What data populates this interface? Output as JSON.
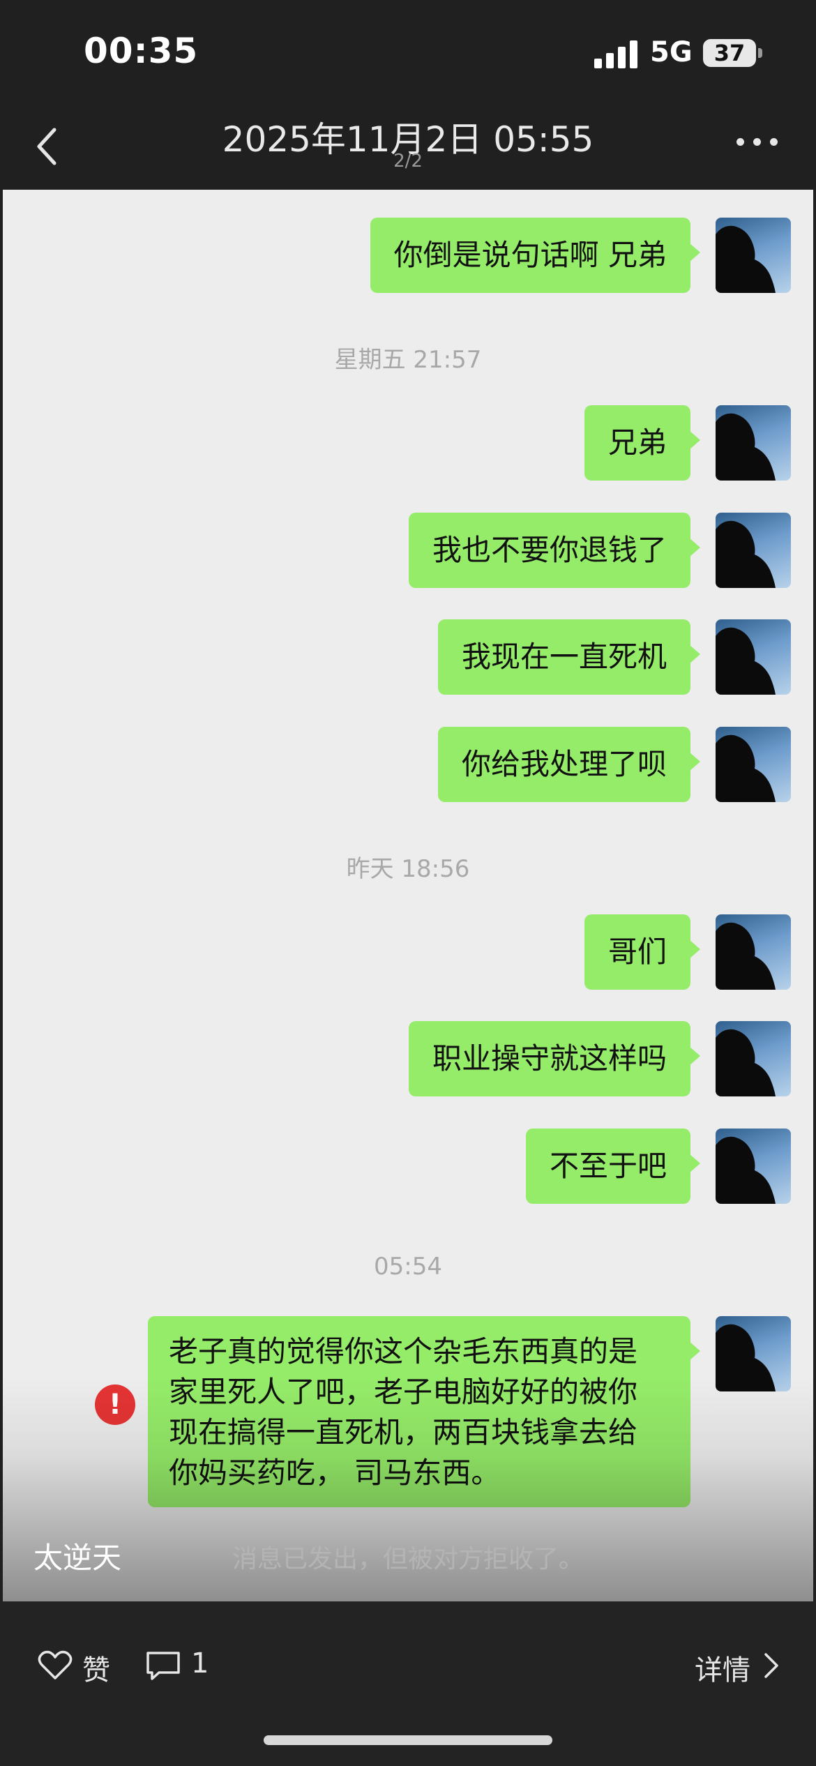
{
  "status_bar": {
    "time": "00:35",
    "network": "5G",
    "battery": "37"
  },
  "nav": {
    "title": "2025年11月2日 05:55",
    "subtitle": "2/2"
  },
  "chat": {
    "messages": [
      {
        "text": "你倒是说句话啊 兄弟"
      },
      {
        "text": "兄弟"
      },
      {
        "text": "我也不要你退钱了"
      },
      {
        "text": "我现在一直死机"
      },
      {
        "text": "你给我处理了呗"
      },
      {
        "text": "哥们"
      },
      {
        "text": "职业操守就这样吗"
      },
      {
        "text": "不至于吧"
      }
    ],
    "timestamps": [
      "星期五 21:57",
      "昨天 18:56",
      "05:54"
    ],
    "long_message": {
      "lines": [
        "老子真的觉得你这个杂毛东西真的是",
        "家里死人了吧，老子电脑好好的被你",
        "现在搞得一直死机，两百块钱拿去给",
        "你妈买药吃， 司马东西。"
      ]
    },
    "error_mark": "!",
    "reject_note": "消息已发出，但被对方拒收了。",
    "author": "太逆天"
  },
  "bottom_bar": {
    "like_label": "赞",
    "comment_count": "1",
    "detail_label": "详情"
  },
  "colors": {
    "bubble": "#95ec69",
    "chat_bg": "#ededed",
    "error": "#e53434",
    "dark_bg": "#202020"
  }
}
